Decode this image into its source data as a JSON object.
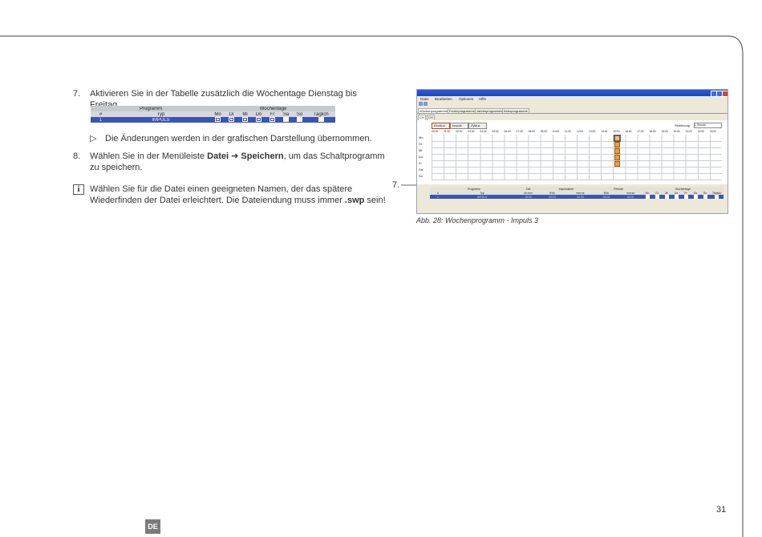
{
  "step7": {
    "number": "7.",
    "text": "Aktivieren Sie in der Tabelle zusätzlich die Wochentage Dienstag bis Freitag."
  },
  "mini_table": {
    "group_headers": [
      "Programm",
      "Wochentage"
    ],
    "columns": [
      "#",
      "Typ",
      "Mo",
      "Di",
      "Mi",
      "Do",
      "Fr",
      "Sa",
      "So",
      "Täglich"
    ],
    "row": {
      "num": "1",
      "typ": "IMPULS"
    },
    "checks": [
      true,
      true,
      true,
      true,
      true,
      false,
      false,
      false
    ]
  },
  "result": {
    "marker": "▷",
    "text": "Die Änderungen werden in der grafischen Darstellung übernommen."
  },
  "step8": {
    "number": "8.",
    "pre": "Wählen Sie in der Menüleiste ",
    "file": "Datei",
    "arrow": "➔",
    "save": "Speichern",
    "post": ", um das Schaltprogramm",
    "line2": "zu speichern."
  },
  "info": {
    "icon": "info-icon",
    "line1": "Wählen Sie für die Datei einen geeigneten Namen, der das spätere",
    "line2_pre": "Wiederfinden der Datei erleichtert. Die Dateiendung muss immer ",
    "ext": ".swp",
    "line2_post": " sein!"
  },
  "screenshot": {
    "menu": [
      "Datei",
      "Bearbeiten",
      "Optionen",
      "Hilfe"
    ],
    "program_tabs": [
      "Wochenprogramme",
      "Ferienprogramme",
      "Jahresprogramme",
      "Astroprogramme"
    ],
    "channel_tabs": [
      "CH 1",
      "CH 2"
    ],
    "buttons": [
      "Ein/Aus",
      "Impuls",
      "Zyklus"
    ],
    "scale_label": "Skalierung",
    "scale_value": "1 Stunde",
    "hours": [
      "00:00",
      "01:00",
      "02:00",
      "03:00",
      "04:00",
      "05:00",
      "06:00",
      "07:00",
      "08:00",
      "09:00",
      "10:00",
      "11:00",
      "12:00",
      "13:00",
      "14:00",
      "15:00",
      "16:00",
      "17:00",
      "18:00",
      "19:00",
      "20:00",
      "21:00",
      "22:00",
      "23:00"
    ],
    "days": [
      "Mo",
      "Di",
      "Mi",
      "Do",
      "Fr",
      "Sa",
      "So"
    ],
    "table_groups": [
      "Programm",
      "Zeit",
      "Impulsdauer",
      "Periode",
      "Wochentage"
    ],
    "table_columns": [
      "#",
      "Typ",
      "hh:mm",
      "ff:hh",
      "mm:ss",
      "ff:hh",
      "mm:ss",
      "Mo",
      "Di",
      "Mi",
      "Do",
      "Fr",
      "Sa",
      "So",
      "Täglich"
    ],
    "table_row": [
      "1",
      "IMPULS",
      "15:00",
      "00:00",
      "00:03",
      "00:00",
      "00:00"
    ]
  },
  "callout": "7.",
  "caption": "Abb. 28:  Wochenprogramm - Impuls 3",
  "page_number": "31",
  "language_badge": "DE"
}
